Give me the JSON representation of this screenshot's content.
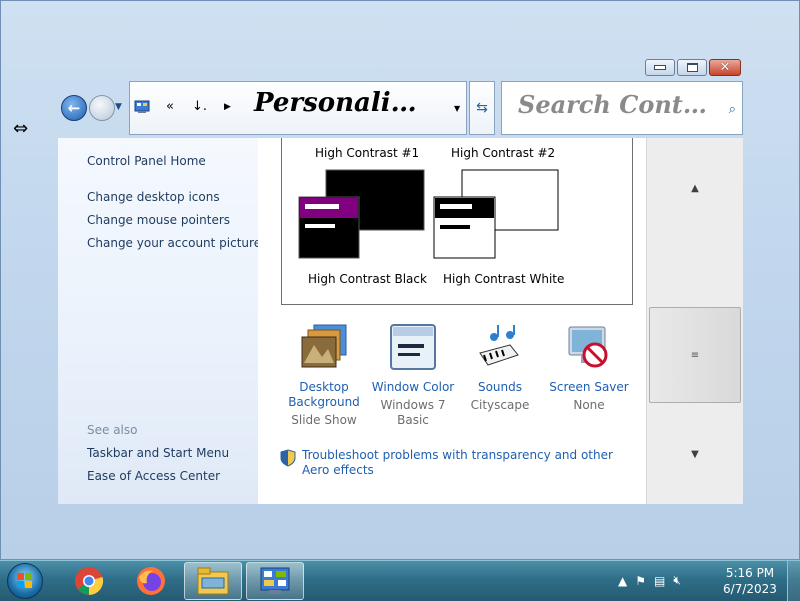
{
  "window": {
    "address": {
      "breadcrumb_overflow": "«",
      "truncated_segment": "↓.",
      "current": "Personali…"
    },
    "search": {
      "placeholder": "Search Cont…"
    }
  },
  "sidebar": {
    "links": [
      "Control Panel Home",
      "Change desktop icons",
      "Change mouse pointers",
      "Change your account picture"
    ],
    "see_also_label": "See also",
    "see_also_links": [
      "Taskbar and Start Menu",
      "Ease of Access Center"
    ]
  },
  "themes": {
    "top_row": [
      "High Contrast #1",
      "High Contrast #2"
    ],
    "bottom_row": [
      "High Contrast Black",
      "High Contrast White"
    ]
  },
  "settings_items": [
    {
      "name": "Desktop Background",
      "value": "Slide Show",
      "icon": "desktop-background-icon"
    },
    {
      "name": "Window Color",
      "value": "Windows 7 Basic",
      "icon": "window-color-icon"
    },
    {
      "name": "Sounds",
      "value": "Cityscape",
      "icon": "sounds-icon"
    },
    {
      "name": "Screen Saver",
      "value": "None",
      "icon": "screen-saver-icon"
    }
  ],
  "troubleshoot_link": "Troubleshoot problems with transparency and other Aero effects",
  "taskbar": {
    "apps": [
      "chrome-icon",
      "firefox-icon",
      "file-explorer-icon",
      "control-panel-icon"
    ],
    "clock_time": "5:16 PM",
    "clock_date": "6/7/2023"
  },
  "colors": {
    "link_blue": "#1f5fb2",
    "taskbar": "#2f6e88"
  }
}
